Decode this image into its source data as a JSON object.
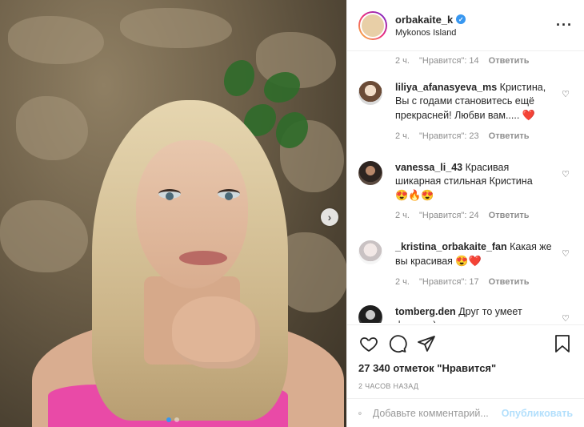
{
  "post": {
    "username": "orbakaite_k",
    "verified": true,
    "location": "Mykonos Island",
    "more_icon": "more-horizontal-icon"
  },
  "first_meta": {
    "time": "2 ч.",
    "likes": "\"Нравится\": 14",
    "reply": "Ответить"
  },
  "comments": [
    {
      "user": "liliya_afanasyeva_ms",
      "text": "Кристина, Вы с годами становитесь ещё прекрасней! Любви вам.....",
      "emoji": "❤️",
      "time": "2 ч.",
      "likes": "\"Нравится\": 23",
      "reply": "Ответить"
    },
    {
      "user": "vanessa_li_43",
      "text": "Красивая шикарная стильная Кристина",
      "emoji": "😍🔥😍",
      "time": "2 ч.",
      "likes": "\"Нравится\": 24",
      "reply": "Ответить"
    },
    {
      "user": "_kristina_orbakaite_fan",
      "text": "Какая же вы красивая",
      "emoji": "😍❤️",
      "time": "2 ч.",
      "likes": "\"Нравится\": 17",
      "reply": "Ответить"
    },
    {
      "user": "tomberg.den",
      "text": "Друг то умеет фоткать)",
      "emoji": "",
      "time": "",
      "likes": "",
      "reply": ""
    }
  ],
  "actions": {
    "likes_text": "27 340 отметок \"Нравится\"",
    "time_ago": "2 ЧАСОВ НАЗАД"
  },
  "add_comment": {
    "placeholder": "Добавьте комментарий...",
    "publish": "Опубликовать"
  },
  "colors": {
    "accent": "#3897f0",
    "publish_disabled": "#b2dffc",
    "heart_red": "#ed4956"
  }
}
